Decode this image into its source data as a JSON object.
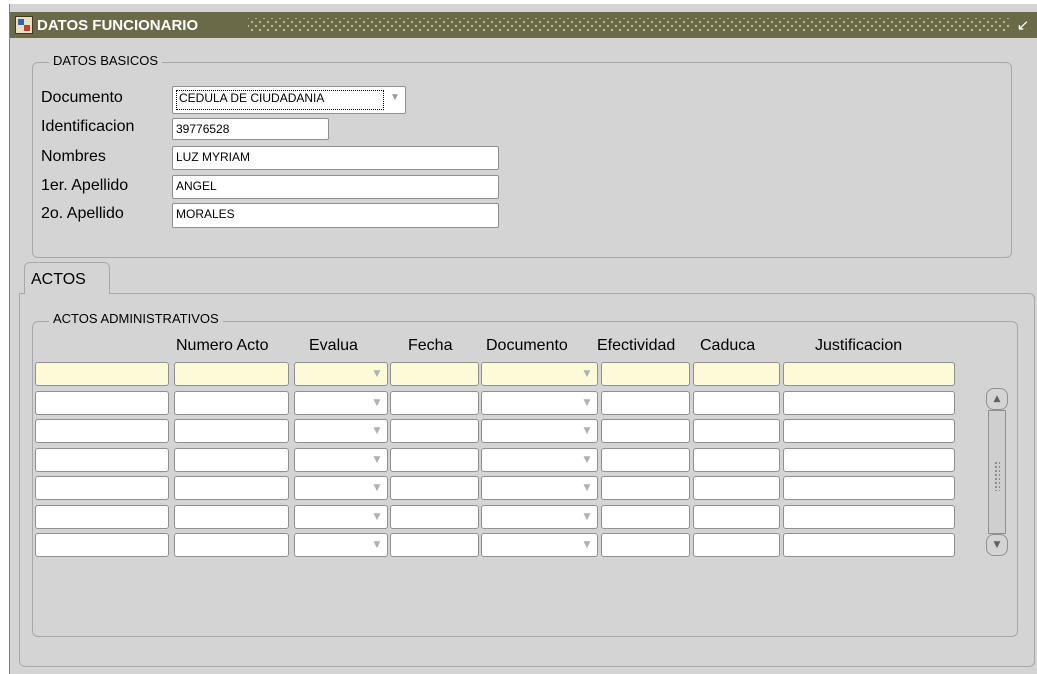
{
  "window": {
    "title": "DATOS FUNCIONARIO"
  },
  "datos_basicos": {
    "group_label": "DATOS BASICOS",
    "labels": {
      "documento": "Documento",
      "identificacion": "Identificacion",
      "nombres": "Nombres",
      "apellido1": "1er. Apellido",
      "apellido2": "2o. Apellido"
    },
    "values": {
      "documento": "CEDULA DE CIUDADANIA",
      "identificacion": "39776528",
      "nombres": "LUZ MYRIAM",
      "apellido1": "ANGEL",
      "apellido2": "MORALES"
    }
  },
  "tabs": [
    {
      "label": "ACTOS"
    }
  ],
  "actos": {
    "group_label": "ACTOS ADMINISTRATIVOS",
    "columns": [
      "",
      "Numero Acto",
      "Evalua",
      "Fecha",
      "Documento",
      "Efectividad",
      "Caduca",
      "Justificacion"
    ],
    "row_count": 7,
    "selected_row": 1
  },
  "colors": {
    "titlebar": "#6a6a48",
    "window_bg": "#d4d4d4",
    "selected_row": "#fdfad8"
  },
  "icons": {
    "app": "forms-app-icon",
    "minimize": "minimize-icon",
    "dropdown": "chevron-down-icon",
    "scroll_up": "scroll-up-icon",
    "scroll_down": "scroll-down-icon"
  }
}
